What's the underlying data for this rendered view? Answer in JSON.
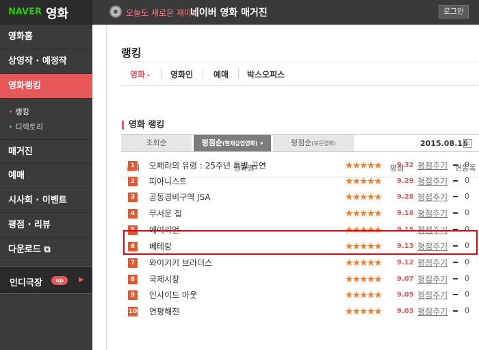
{
  "header": {
    "logo_naver": "NAVER",
    "logo_movie": "영화",
    "tagline": "오늘도 새로운 재미!",
    "magazine": "네이버 영화 매거진",
    "login_label": "로그인",
    "magazine_icon": "film-reel-icon"
  },
  "sidebar": {
    "items": [
      {
        "label": "영화홈"
      },
      {
        "label": "상영작 · 예정작"
      },
      {
        "label": "영화랭킹"
      },
      {
        "label": "매거진"
      },
      {
        "label": "예매"
      },
      {
        "label": "시사회 · 이벤트"
      },
      {
        "label": "평점 · 리뷰"
      },
      {
        "label": "다운로드 ⧉"
      }
    ],
    "subitems": [
      {
        "label": "랭킹"
      },
      {
        "label": "디렉토리"
      }
    ],
    "indie": {
      "label": "인디극장",
      "badge": "up",
      "arrow": "▶"
    }
  },
  "main": {
    "title": "랭킹",
    "nav": [
      {
        "label": "영화",
        "caret": "▾"
      },
      {
        "label": "영화인"
      },
      {
        "label": "예매"
      },
      {
        "label": "박스오피스"
      }
    ],
    "section_title": "영화 랭킹",
    "sort_tabs": [
      {
        "label": "조회순"
      },
      {
        "label": "평점순",
        "small": "(현재상영영화)",
        "caret": "▾"
      },
      {
        "label": "평점순",
        "small": "(모든영화)"
      }
    ],
    "date": "2015.08.16",
    "date_btn": "<",
    "table_headers": {
      "rank": "순위",
      "title": "영화명",
      "score": "평점",
      "change": "변동폭"
    },
    "rows": [
      {
        "rank": "1",
        "title": "오페라의 유령 : 25주년 특별 공연",
        "score": "9.32",
        "rate": "평점주기",
        "change": "0"
      },
      {
        "rank": "2",
        "title": "피아니스트",
        "score": "9.29",
        "rate": "평점주기",
        "change": "0"
      },
      {
        "rank": "3",
        "title": "공동경비구역 JSA",
        "score": "9.28",
        "rate": "평점주기",
        "change": "0"
      },
      {
        "rank": "4",
        "title": "무서운 집",
        "score": "9.16",
        "rate": "평점주기",
        "change": "0"
      },
      {
        "rank": "5",
        "title": "에이리언",
        "score": "9.15",
        "rate": "평점주기",
        "change": "0"
      },
      {
        "rank": "6",
        "title": "베테랑",
        "score": "9.13",
        "rate": "평점주기",
        "change": "0"
      },
      {
        "rank": "7",
        "title": "와이키키 브라더스",
        "score": "9.12",
        "rate": "평점주기",
        "change": "0"
      },
      {
        "rank": "8",
        "title": "국제시장",
        "score": "9.07",
        "rate": "평점주기",
        "change": "0"
      },
      {
        "rank": "9",
        "title": "인사이드 아웃",
        "score": "9.05",
        "rate": "평점주기",
        "change": "0"
      },
      {
        "rank": "10",
        "title": "연평해전",
        "score": "9.03",
        "rate": "평점주기",
        "change": "0"
      }
    ]
  },
  "colors": {
    "accent": "#e85757",
    "star": "#f08030",
    "rank_badge": "#e8562e",
    "highlight": "#e60012",
    "brand_green": "#2cc70f"
  }
}
